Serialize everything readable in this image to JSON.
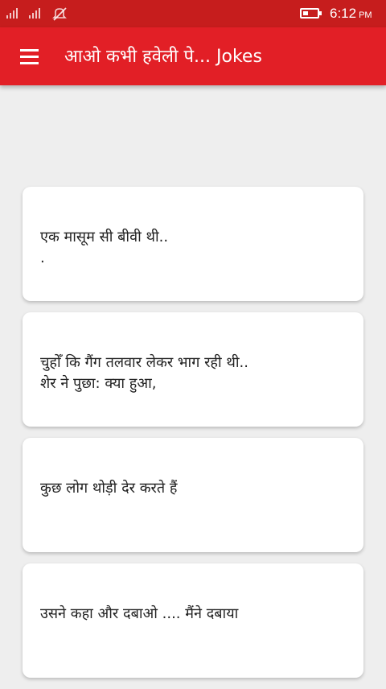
{
  "status_bar": {
    "time": "6:12",
    "ampm": "PM",
    "icons": [
      "signal-icon",
      "signal-icon",
      "mute-icon",
      "battery-icon"
    ]
  },
  "toolbar": {
    "menu_icon": "hamburger-menu-icon",
    "title": "आओ कभी हवेली पे... Jokes",
    "background_color": "#e21f26"
  },
  "jokes": [
    {
      "text": "एक मासूम सी बीवी थी..\n."
    },
    {
      "text": "चुहोँ कि गैंग तलवार लेकर भाग रही थी..\nशेर ने पुछा: क्या हुआ,"
    },
    {
      "text": "कुछ लोग थोड़ी देर करते हैं"
    },
    {
      "text": "उसने कहा और दबाओ .... मैंने दबाया"
    }
  ]
}
